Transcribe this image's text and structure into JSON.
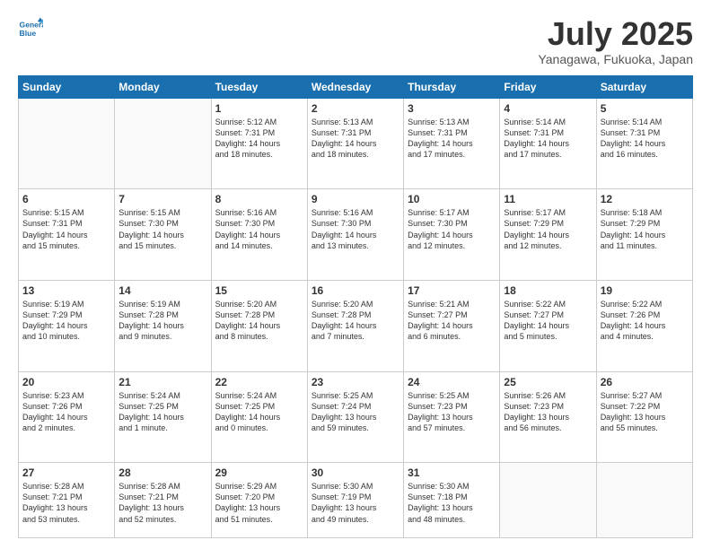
{
  "header": {
    "logo_line1": "General",
    "logo_line2": "Blue",
    "month_title": "July 2025",
    "location": "Yanagawa, Fukuoka, Japan"
  },
  "weekdays": [
    "Sunday",
    "Monday",
    "Tuesday",
    "Wednesday",
    "Thursday",
    "Friday",
    "Saturday"
  ],
  "weeks": [
    [
      {
        "day": "",
        "info": ""
      },
      {
        "day": "",
        "info": ""
      },
      {
        "day": "1",
        "info": "Sunrise: 5:12 AM\nSunset: 7:31 PM\nDaylight: 14 hours\nand 18 minutes."
      },
      {
        "day": "2",
        "info": "Sunrise: 5:13 AM\nSunset: 7:31 PM\nDaylight: 14 hours\nand 18 minutes."
      },
      {
        "day": "3",
        "info": "Sunrise: 5:13 AM\nSunset: 7:31 PM\nDaylight: 14 hours\nand 17 minutes."
      },
      {
        "day": "4",
        "info": "Sunrise: 5:14 AM\nSunset: 7:31 PM\nDaylight: 14 hours\nand 17 minutes."
      },
      {
        "day": "5",
        "info": "Sunrise: 5:14 AM\nSunset: 7:31 PM\nDaylight: 14 hours\nand 16 minutes."
      }
    ],
    [
      {
        "day": "6",
        "info": "Sunrise: 5:15 AM\nSunset: 7:31 PM\nDaylight: 14 hours\nand 15 minutes."
      },
      {
        "day": "7",
        "info": "Sunrise: 5:15 AM\nSunset: 7:30 PM\nDaylight: 14 hours\nand 15 minutes."
      },
      {
        "day": "8",
        "info": "Sunrise: 5:16 AM\nSunset: 7:30 PM\nDaylight: 14 hours\nand 14 minutes."
      },
      {
        "day": "9",
        "info": "Sunrise: 5:16 AM\nSunset: 7:30 PM\nDaylight: 14 hours\nand 13 minutes."
      },
      {
        "day": "10",
        "info": "Sunrise: 5:17 AM\nSunset: 7:30 PM\nDaylight: 14 hours\nand 12 minutes."
      },
      {
        "day": "11",
        "info": "Sunrise: 5:17 AM\nSunset: 7:29 PM\nDaylight: 14 hours\nand 12 minutes."
      },
      {
        "day": "12",
        "info": "Sunrise: 5:18 AM\nSunset: 7:29 PM\nDaylight: 14 hours\nand 11 minutes."
      }
    ],
    [
      {
        "day": "13",
        "info": "Sunrise: 5:19 AM\nSunset: 7:29 PM\nDaylight: 14 hours\nand 10 minutes."
      },
      {
        "day": "14",
        "info": "Sunrise: 5:19 AM\nSunset: 7:28 PM\nDaylight: 14 hours\nand 9 minutes."
      },
      {
        "day": "15",
        "info": "Sunrise: 5:20 AM\nSunset: 7:28 PM\nDaylight: 14 hours\nand 8 minutes."
      },
      {
        "day": "16",
        "info": "Sunrise: 5:20 AM\nSunset: 7:28 PM\nDaylight: 14 hours\nand 7 minutes."
      },
      {
        "day": "17",
        "info": "Sunrise: 5:21 AM\nSunset: 7:27 PM\nDaylight: 14 hours\nand 6 minutes."
      },
      {
        "day": "18",
        "info": "Sunrise: 5:22 AM\nSunset: 7:27 PM\nDaylight: 14 hours\nand 5 minutes."
      },
      {
        "day": "19",
        "info": "Sunrise: 5:22 AM\nSunset: 7:26 PM\nDaylight: 14 hours\nand 4 minutes."
      }
    ],
    [
      {
        "day": "20",
        "info": "Sunrise: 5:23 AM\nSunset: 7:26 PM\nDaylight: 14 hours\nand 2 minutes."
      },
      {
        "day": "21",
        "info": "Sunrise: 5:24 AM\nSunset: 7:25 PM\nDaylight: 14 hours\nand 1 minute."
      },
      {
        "day": "22",
        "info": "Sunrise: 5:24 AM\nSunset: 7:25 PM\nDaylight: 14 hours\nand 0 minutes."
      },
      {
        "day": "23",
        "info": "Sunrise: 5:25 AM\nSunset: 7:24 PM\nDaylight: 13 hours\nand 59 minutes."
      },
      {
        "day": "24",
        "info": "Sunrise: 5:25 AM\nSunset: 7:23 PM\nDaylight: 13 hours\nand 57 minutes."
      },
      {
        "day": "25",
        "info": "Sunrise: 5:26 AM\nSunset: 7:23 PM\nDaylight: 13 hours\nand 56 minutes."
      },
      {
        "day": "26",
        "info": "Sunrise: 5:27 AM\nSunset: 7:22 PM\nDaylight: 13 hours\nand 55 minutes."
      }
    ],
    [
      {
        "day": "27",
        "info": "Sunrise: 5:28 AM\nSunset: 7:21 PM\nDaylight: 13 hours\nand 53 minutes."
      },
      {
        "day": "28",
        "info": "Sunrise: 5:28 AM\nSunset: 7:21 PM\nDaylight: 13 hours\nand 52 minutes."
      },
      {
        "day": "29",
        "info": "Sunrise: 5:29 AM\nSunset: 7:20 PM\nDaylight: 13 hours\nand 51 minutes."
      },
      {
        "day": "30",
        "info": "Sunrise: 5:30 AM\nSunset: 7:19 PM\nDaylight: 13 hours\nand 49 minutes."
      },
      {
        "day": "31",
        "info": "Sunrise: 5:30 AM\nSunset: 7:18 PM\nDaylight: 13 hours\nand 48 minutes."
      },
      {
        "day": "",
        "info": ""
      },
      {
        "day": "",
        "info": ""
      }
    ]
  ]
}
